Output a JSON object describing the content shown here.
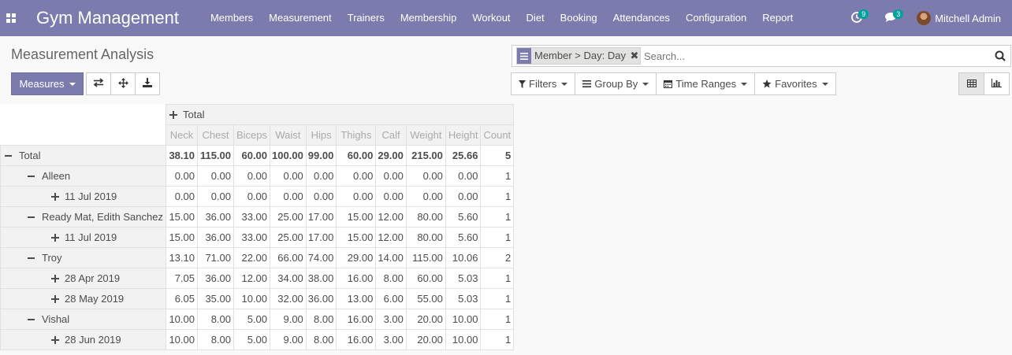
{
  "app": {
    "title": "Gym Management"
  },
  "nav": {
    "items": [
      {
        "label": "Members"
      },
      {
        "label": "Measurement"
      },
      {
        "label": "Trainers"
      },
      {
        "label": "Membership"
      },
      {
        "label": "Workout"
      },
      {
        "label": "Diet"
      },
      {
        "label": "Booking"
      },
      {
        "label": "Attendances"
      },
      {
        "label": "Configuration"
      },
      {
        "label": "Report"
      }
    ],
    "activity_count": "9",
    "messages_count": "3",
    "user_name": "Mitchell Admin"
  },
  "page": {
    "title": "Measurement Analysis"
  },
  "search": {
    "facet_value": "Member > Day: Day",
    "placeholder": "Search..."
  },
  "toolbar": {
    "measures_label": "Measures",
    "filters_label": "Filters",
    "groupby_label": "Group By",
    "timeranges_label": "Time Ranges",
    "favorites_label": "Favorites"
  },
  "colors": {
    "brand": "#7c7bad",
    "badge": "#00a09d"
  },
  "pivot": {
    "col_total_label": "Total",
    "measures": [
      "Neck",
      "Chest",
      "Biceps",
      "Waist",
      "Hips",
      "Thighs",
      "Calf",
      "Weight",
      "Height",
      "Count"
    ],
    "rows": [
      {
        "label": "Total",
        "level": 0,
        "expanded": true,
        "values": [
          "38.10",
          "115.00",
          "60.00",
          "100.00",
          "99.00",
          "60.00",
          "29.00",
          "215.00",
          "25.66",
          "5"
        ]
      },
      {
        "label": "Alleen",
        "level": 1,
        "expanded": true,
        "values": [
          "0.00",
          "0.00",
          "0.00",
          "0.00",
          "0.00",
          "0.00",
          "0.00",
          "0.00",
          "0.00",
          "1"
        ]
      },
      {
        "label": "11 Jul 2019",
        "level": 2,
        "expanded": false,
        "values": [
          "0.00",
          "0.00",
          "0.00",
          "0.00",
          "0.00",
          "0.00",
          "0.00",
          "0.00",
          "0.00",
          "1"
        ]
      },
      {
        "label": "Ready Mat, Edith Sanchez",
        "level": 1,
        "expanded": true,
        "values": [
          "15.00",
          "36.00",
          "33.00",
          "25.00",
          "17.00",
          "15.00",
          "12.00",
          "80.00",
          "5.60",
          "1"
        ]
      },
      {
        "label": "11 Jul 2019",
        "level": 2,
        "expanded": false,
        "values": [
          "15.00",
          "36.00",
          "33.00",
          "25.00",
          "17.00",
          "15.00",
          "12.00",
          "80.00",
          "5.60",
          "1"
        ]
      },
      {
        "label": "Troy",
        "level": 1,
        "expanded": true,
        "values": [
          "13.10",
          "71.00",
          "22.00",
          "66.00",
          "74.00",
          "29.00",
          "14.00",
          "115.00",
          "10.06",
          "2"
        ]
      },
      {
        "label": "28 Apr 2019",
        "level": 2,
        "expanded": false,
        "values": [
          "7.05",
          "36.00",
          "12.00",
          "34.00",
          "38.00",
          "16.00",
          "8.00",
          "60.00",
          "5.03",
          "1"
        ]
      },
      {
        "label": "28 May 2019",
        "level": 2,
        "expanded": false,
        "values": [
          "6.05",
          "35.00",
          "10.00",
          "32.00",
          "36.00",
          "13.00",
          "6.00",
          "55.00",
          "5.03",
          "1"
        ]
      },
      {
        "label": "Vishal",
        "level": 1,
        "expanded": true,
        "values": [
          "10.00",
          "8.00",
          "5.00",
          "9.00",
          "8.00",
          "16.00",
          "3.00",
          "20.00",
          "10.00",
          "1"
        ]
      },
      {
        "label": "28 Jun 2019",
        "level": 2,
        "expanded": false,
        "values": [
          "10.00",
          "8.00",
          "5.00",
          "9.00",
          "8.00",
          "16.00",
          "3.00",
          "20.00",
          "10.00",
          "1"
        ]
      }
    ]
  }
}
